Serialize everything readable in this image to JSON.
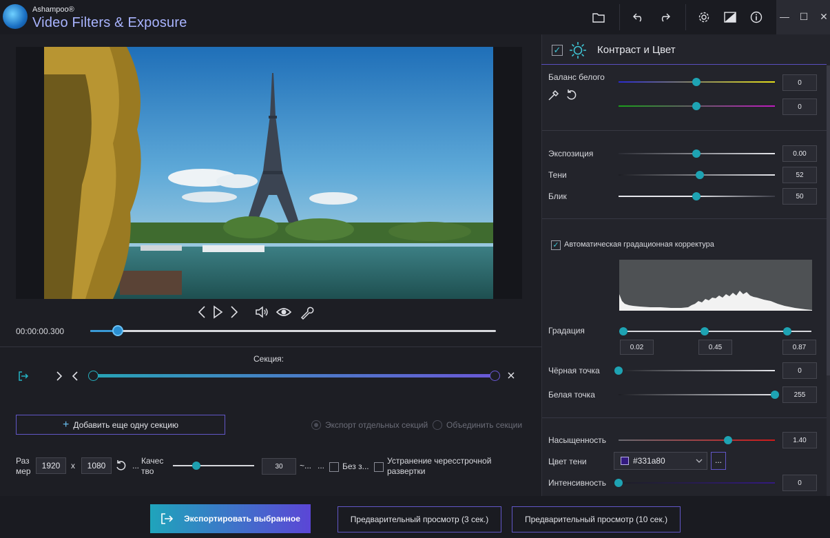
{
  "app": {
    "brand_small": "Ashampoo®",
    "brand_name": "Video Filters & Exposure"
  },
  "toolbar": {
    "icons": [
      "folder-icon",
      "undo-icon",
      "redo-icon",
      "gear-icon",
      "theme-icon",
      "info-icon"
    ],
    "window": {
      "minimize": "—",
      "maximize": "☐",
      "close": "✕"
    }
  },
  "player": {
    "timecode": "00:00:00.300",
    "progress": 0.068
  },
  "section": {
    "label": "Секция:",
    "add_button": "Добавить еще одну секцию",
    "export_separate": "Экспорт отдельных секций",
    "merge_sections": "Объединить секции"
  },
  "output": {
    "size_label_1": "Раз",
    "size_label_2": "мер",
    "width": "1920",
    "x": "x",
    "height": "1080",
    "ellipsis": "...",
    "quality_label_1": "Качес",
    "quality_label_2": "тво",
    "quality_value": "30",
    "approx": "~...",
    "ellipsis2": "...",
    "no_sound": "Без з...",
    "deinterlace_1": "Устранение чересстрочной",
    "deinterlace_2": "развертки"
  },
  "bottom": {
    "export_button": "Экспортировать выбранное",
    "preview_3": "Предварительный просмотр (3 сек.)",
    "preview_10": "Предварительный просмотр (10 сек.)"
  },
  "panel": {
    "title": "Контраст и Цвет",
    "white_balance": "Баланс белого",
    "wb_value_1": "0",
    "wb_value_2": "0",
    "exposure": "Экспозиция",
    "exposure_value": "0.00",
    "shadows": "Тени",
    "shadows_value": "52",
    "highlight": "Блик",
    "highlight_value": "50",
    "auto_levels": "Автоматическая градационная корректура",
    "gradation": "Градация",
    "grad_low": "0.02",
    "grad_mid": "0.45",
    "grad_high": "0.87",
    "black_point": "Чёрная точка",
    "black_value": "0",
    "white_point": "Белая точка",
    "white_value": "255",
    "saturation": "Насыщенность",
    "saturation_value": "1.40",
    "shadow_color": "Цвет тени",
    "shadow_color_value": "#331a80",
    "shadow_color_btn": "...",
    "intensity": "Интенсивность",
    "intensity_value": "0"
  },
  "colors": {
    "accent_teal": "#1ea3b3",
    "accent_purple": "#6257c8",
    "shadow_swatch": "#331a80"
  }
}
